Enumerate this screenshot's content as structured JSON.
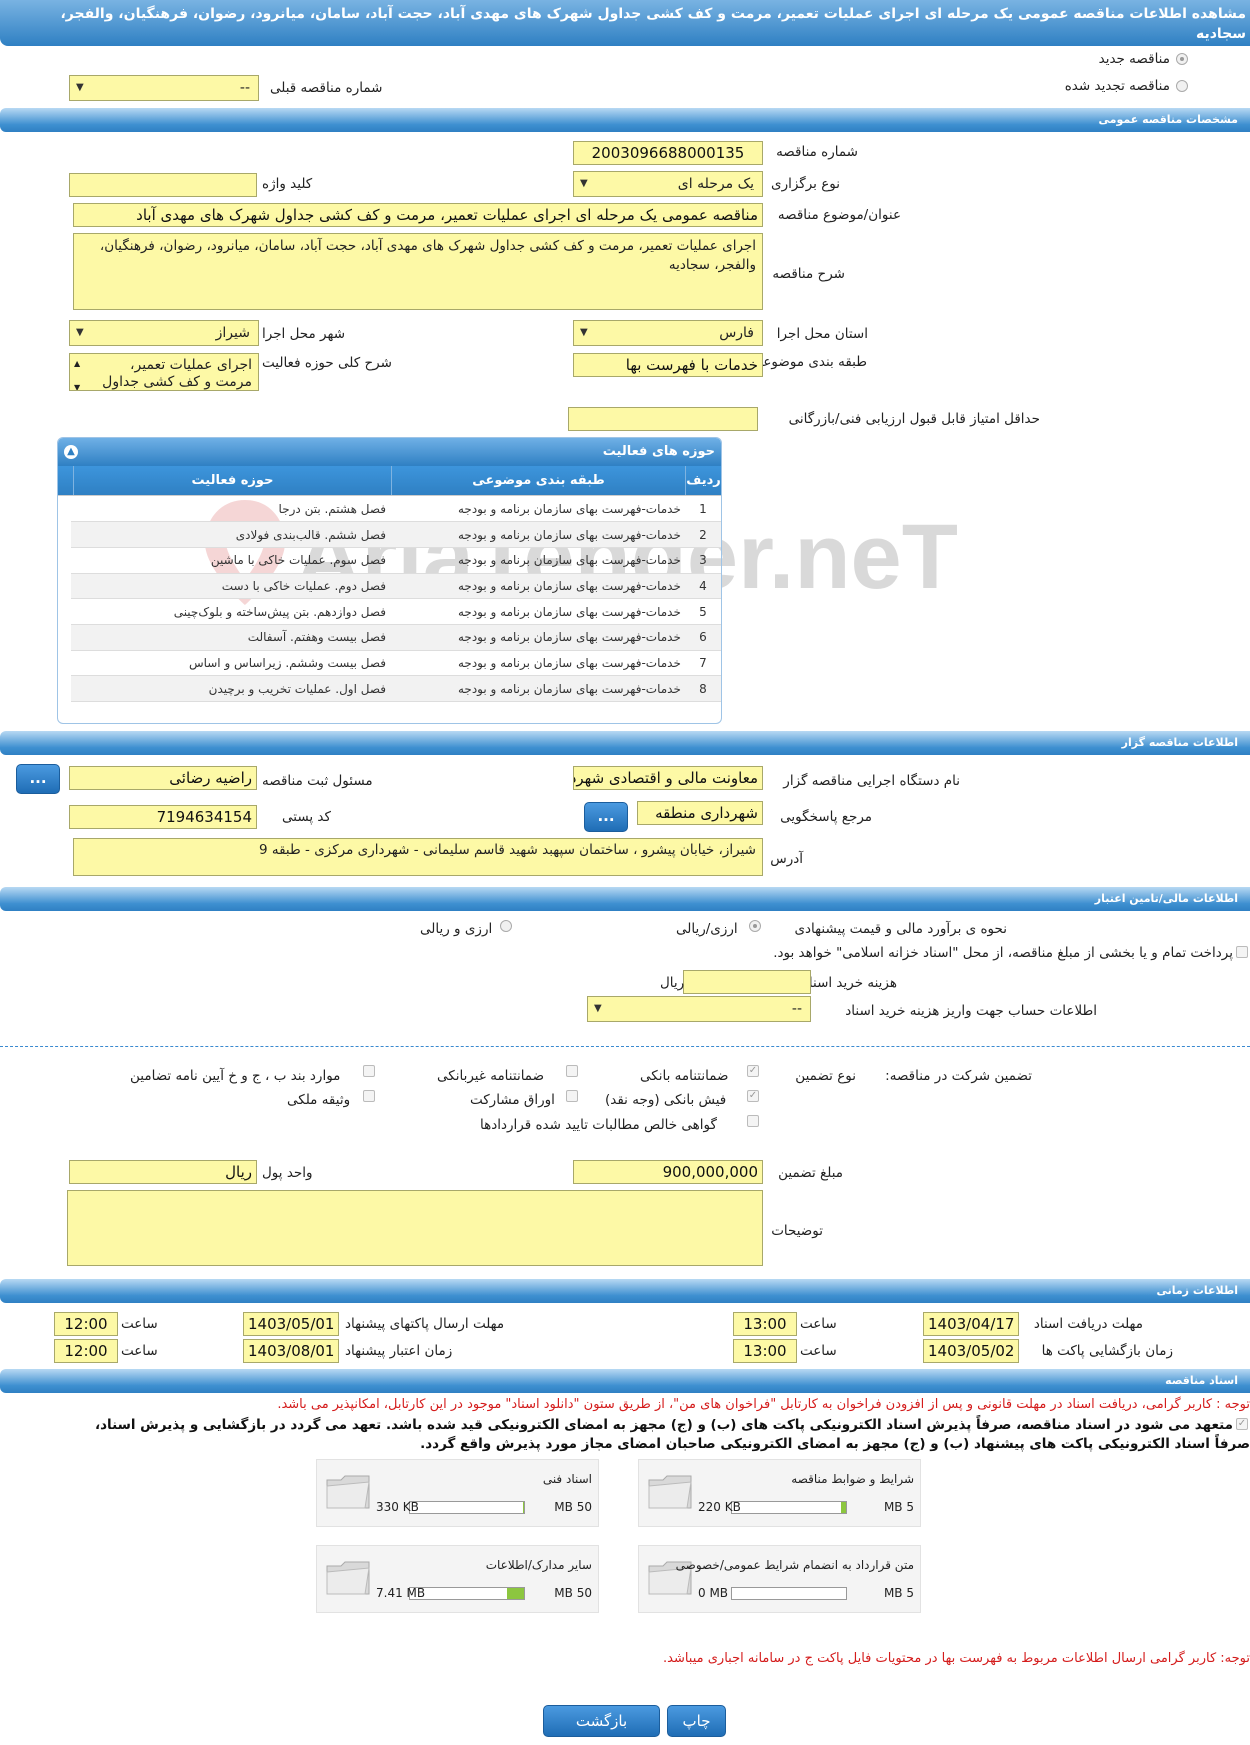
{
  "header": {
    "title": "مشاهده اطلاعات مناقصه عمومی یک مرحله ای اجرای عملیات تعمیر، مرمت و کف کشی جداول شهرک های مهدی آباد، حجت آباد، سامان، میانرود، رضوان، فرهنگیان، والفجر، سجادیه"
  },
  "top": {
    "new_tender": "مناقصه جدید",
    "renewed_tender": "مناقصه تجدید شده",
    "prev_number_label": "شماره مناقصه قبلی",
    "prev_number_value": "--"
  },
  "general": {
    "section": "مشخصات مناقصه عمومی",
    "number_label": "شماره مناقصه",
    "number_value": "2003096688000135",
    "type_label": "نوع برگزاری",
    "type_value": "یک مرحله ای",
    "keyword_label": "کلید واژه",
    "keyword_value": "",
    "title_label": "عنوان/موضوع مناقصه",
    "title_value": "مناقصه عمومی یک مرحله ای اجرای عملیات تعمیر، مرمت و کف کشی جداول شهرک های مهدی آباد",
    "desc_label": "شرح مناقصه",
    "desc_value": "اجرای عملیات تعمیر، مرمت و کف کشی جداول شهرک های مهدی آباد، حجت آباد، سامان، میانرود، رضوان، فرهنگیان، والفجر، سجادیه",
    "province_label": "استان محل اجرا",
    "province_value": "فارس",
    "city_label": "شهر محل اجرا",
    "city_value": "شیراز",
    "category_label": "طبقه بندی موضوعی",
    "category_value": "خدمات با فهرست بها",
    "scope_label": "شرح کلی حوزه فعالیت",
    "scope_value": "اجرای عملیات تعمیر، مرمت و کف کشی جداول",
    "min_score_label": "حداقل امتیاز قابل قبول ارزیابی فنی/بازرگانی",
    "min_score_value": ""
  },
  "activities": {
    "title": "حوزه های فعالیت",
    "col_row": "ردیف",
    "col_category": "طبقه بندی موضوعی",
    "col_field": "حوزه فعالیت",
    "rows": [
      {
        "n": "1",
        "cat": "خدمات-فهرست بهای سازمان برنامه و بودجه",
        "field": "فصل هشتم. بتن درجا"
      },
      {
        "n": "2",
        "cat": "خدمات-فهرست بهای سازمان برنامه و بودجه",
        "field": "فصل ششم. قالب‌بندی فولادی"
      },
      {
        "n": "3",
        "cat": "خدمات-فهرست بهای سازمان برنامه و بودجه",
        "field": "فصل سوم. عملیات خاکی با ماشین"
      },
      {
        "n": "4",
        "cat": "خدمات-فهرست بهای سازمان برنامه و بودجه",
        "field": "فصل دوم. عملیات خاکی با دست"
      },
      {
        "n": "5",
        "cat": "خدمات-فهرست بهای سازمان برنامه و بودجه",
        "field": "فصل دوازدهم. بتن پیش‌ساخته و بلوک‌چینی"
      },
      {
        "n": "6",
        "cat": "خدمات-فهرست بهای سازمان برنامه و بودجه",
        "field": "فصل بیست وهفتم. آسفالت"
      },
      {
        "n": "7",
        "cat": "خدمات-فهرست بهای سازمان برنامه و بودجه",
        "field": "فصل بیست وششم. زیراساس و اساس"
      },
      {
        "n": "8",
        "cat": "خدمات-فهرست بهای سازمان برنامه و بودجه",
        "field": "فصل اول. عملیات تخریب و برچیدن"
      }
    ]
  },
  "organizer": {
    "section": "اطلاعات مناقصه گزار",
    "org_label": "نام دستگاه اجرایی مناقصه گزار",
    "org_value": "معاونت مالی و اقتصادی شهرداری",
    "registrar_label": "مسئول ثبت مناقصه",
    "registrar_value": "راضیه رضائی",
    "ref_label": "مرجع پاسخگویی",
    "ref_value": "شهرداری منطقه",
    "postal_label": "کد پستی",
    "postal_value": "7194634154",
    "address_label": "آدرس",
    "address_value": "شیراز، خیابان پیشرو ، ساختمان سپهبد شهید قاسم سلیمانی - شهرداری مرکزی - طبقه 9",
    "browse": "..."
  },
  "finance": {
    "section": "اطلاعات مالی/تامین اعتبار",
    "method_label": "نحوه ی برآورد مالی و قیمت پیشنهادی",
    "opt1": "ارزی/ریالی",
    "opt2": "ارزی و ریالی",
    "treasury": "پرداخت تمام و یا بخشی از مبلغ مناقصه، از محل \"اسناد خزانه اسلامی\" خواهد بود.",
    "doc_fee_label": "هزینه خرید اسناد",
    "doc_fee_unit": "ریال",
    "account_label": "اطلاعات حساب جهت واریز هزینه خرید اسناد",
    "account_value": "--"
  },
  "guarantee": {
    "label": "تضمین شرکت در مناقصه:",
    "type_label": "نوع تضمین",
    "bank_guarantee": "ضمانتنامه بانکی",
    "non_bank": "ضمانتنامه غیربانکی",
    "clauses": "موارد بند ب ، ج و خ آیین نامه تضامین",
    "bank_receipt": "فیش بانکی (وجه نقد)",
    "bonds": "اوراق مشارکت",
    "property": "وثیقه ملکی",
    "claims": "گواهی خالص مطالبات تایید شده قراردادها",
    "amount_label": "مبلغ تضمین",
    "amount_value": "900,000,000",
    "currency_label": "واحد پول",
    "currency_value": "ریال",
    "notes_label": "توضیحات"
  },
  "timing": {
    "section": "اطلاعات زمانی",
    "receive_label": "مهلت دریافت اسناد",
    "receive_date": "1403/04/17",
    "receive_time": "13:00",
    "send_label": "مهلت ارسال پاکتهای پیشنهاد",
    "send_date": "1403/05/01",
    "send_time": "12:00",
    "open_label": "زمان بازگشایی پاکت ها",
    "open_date": "1403/05/02",
    "open_time": "13:00",
    "valid_label": "زمان اعتبار پیشنهاد",
    "valid_date": "1403/08/01",
    "valid_time": "12:00",
    "time_label": "ساعت"
  },
  "docs": {
    "section": "اسناد مناقصه",
    "notice": "توجه : کاربر گرامی، دریافت اسناد در مهلت قانونی و پس از افزودن فراخوان به کارتابل \"فراخوان های من\"، از طریق ستون \"دانلود اسناد\" موجود در این کارتابل، امکانپذیر می باشد.",
    "commit1": "متعهد می شود در اسناد مناقصه، صرفاً پذیرش اسناد الکترونیکی پاکت های (ب) و (ج) مجهز به امضای الکترونیکی قید شده باشد. تعهد می گردد در بازگشایی و پذیرش اسناد،",
    "commit2": "صرفاً اسناد الکترونیکی پاکت های پیشنهاد (ب) و (ج) مجهز به امضای الکترونیکی صاحبان امضای مجاز مورد پذیرش واقع گردد.",
    "tiles": [
      {
        "name": "شرایط و ضوابط مناقصه",
        "size": "220 KB",
        "max": "5 MB",
        "fill": 0.04
      },
      {
        "name": "اسناد فنی",
        "size": "330 KB",
        "max": "50 MB",
        "fill": 0.01
      },
      {
        "name": "متن قرارداد به انضمام شرایط عمومی/خصوصی",
        "size": "0 MB",
        "max": "5 MB",
        "fill": 0
      },
      {
        "name": "سایر مدارک/اطلاعات",
        "size": "7.41 MB",
        "max": "50 MB",
        "fill": 0.15
      }
    ],
    "footnote": "توجه: کاربر گرامی ارسال اطلاعات مربوط به فهرست بها در محتویات فایل پاکت ج در سامانه اجباری میباشد."
  },
  "buttons": {
    "print": "چاپ",
    "back": "بازگشت"
  },
  "watermark": "AriaTender.neT"
}
